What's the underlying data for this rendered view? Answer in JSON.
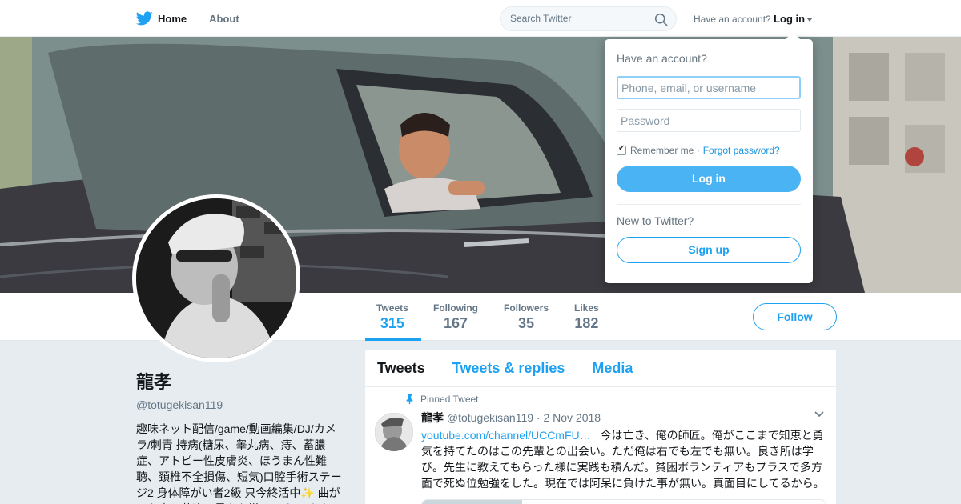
{
  "nav": {
    "home_label": "Home",
    "about_label": "About",
    "search_placeholder": "Search Twitter",
    "account_prompt": "Have an account?",
    "login_label": "Log in"
  },
  "profile": {
    "name": "龍孝",
    "handle": "@totugekisan119",
    "bio": "趣味ネット配信/game/動画編集/DJ/カメラ/刺青 持病(糖尿、睾丸病、痔、蓄膿症、アトピー性皮膚炎、ほうまん性難聴、頚椎不全損傷、短気)口腔手術ステージ2 身体障がい者2級 只今終活中✨ 曲がった事と薬物、暴力も嫌いです 死ぬまで"
  },
  "stats": [
    {
      "label": "Tweets",
      "value": "315"
    },
    {
      "label": "Following",
      "value": "167"
    },
    {
      "label": "Followers",
      "value": "35"
    },
    {
      "label": "Likes",
      "value": "182"
    }
  ],
  "follow_label": "Follow",
  "timeline": {
    "tabs": [
      "Tweets",
      "Tweets & replies",
      "Media"
    ],
    "tweet": {
      "pinned_label": "Pinned Tweet",
      "author": "龍孝",
      "handle": "@totugekisan119",
      "date": "· 2 Nov 2018",
      "link": "youtube.com/channel/UCCmFU…",
      "text": "今は亡き、俺の師匠。俺がここまで知恵と勇気を持てたのはこの先輩との出会い。ただ俺は右でも左でも無い。良き所は学び。先生に教えてもらった様に実践も積んだ。貧困ボランティアもプラスで多方面で死ぬ位勉強をした。現在では阿呆に負けた事が無い。真面目にしてるから。"
    }
  },
  "login_dropdown": {
    "title": "Have an account?",
    "username_placeholder": "Phone, email, or username",
    "password_placeholder": "Password",
    "remember_label": "Remember me ·",
    "forgot_label": "Forgot password?",
    "login_button": "Log in",
    "new_prompt": "New to Twitter?",
    "signup_button": "Sign up"
  },
  "colors": {
    "brand": "#1da1f2",
    "login_button": "#4ab3f4"
  },
  "icons": [
    "twitter-bird-icon",
    "search-icon",
    "caret-down-icon",
    "pin-icon",
    "chevron-down-icon"
  ]
}
